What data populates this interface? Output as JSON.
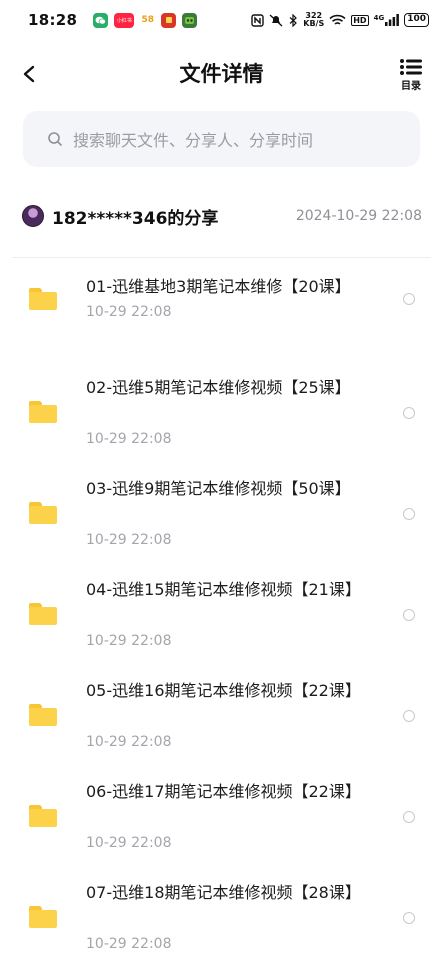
{
  "status_bar": {
    "time": "18:28",
    "apps": [
      {
        "icon": "wechat-icon",
        "color": "#2aae67",
        "text": ""
      },
      {
        "icon": "xiaohongshu-icon",
        "color": "#ff2442",
        "text": "小红书"
      },
      {
        "icon": "58-icon",
        "color": "#ffffff",
        "text": "58"
      },
      {
        "icon": "app-icon",
        "color": "#d9352b",
        "text": ""
      },
      {
        "icon": "game-icon",
        "color": "#3a7a3a",
        "text": ""
      }
    ],
    "network_speed_value": "322",
    "network_speed_unit": "KB/S",
    "hd_label": "HD",
    "signal_label": "4G",
    "battery": "100"
  },
  "header": {
    "title": "文件详情",
    "catalog_label": "目录"
  },
  "search": {
    "placeholder": "搜索聊天文件、分享人、分享时间"
  },
  "share": {
    "user": "182*****346的分享",
    "time": "2024-10-29  22:08"
  },
  "files": [
    {
      "name": "01-迅维基地3期笔记本维修【20课】",
      "time": "10-29  22:08"
    },
    {
      "name": "02-迅维5期笔记本维修视频【25课】",
      "time": "10-29  22:08"
    },
    {
      "name": "03-迅维9期笔记本维修视频【50课】",
      "time": "10-29  22:08"
    },
    {
      "name": "04-迅维15期笔记本维修视频【21课】",
      "time": "10-29  22:08"
    },
    {
      "name": "05-迅维16期笔记本维修视频【22课】",
      "time": "10-29  22:08"
    },
    {
      "name": "06-迅维17期笔记本维修视频【22课】",
      "time": "10-29  22:08"
    },
    {
      "name": "07-迅维18期笔记本维修视频【28课】",
      "time": "10-29  22:08"
    }
  ],
  "colors": {
    "folder": "#fbd24a",
    "search_bg": "#f4f5f9",
    "muted_text": "#a3a5ab"
  }
}
